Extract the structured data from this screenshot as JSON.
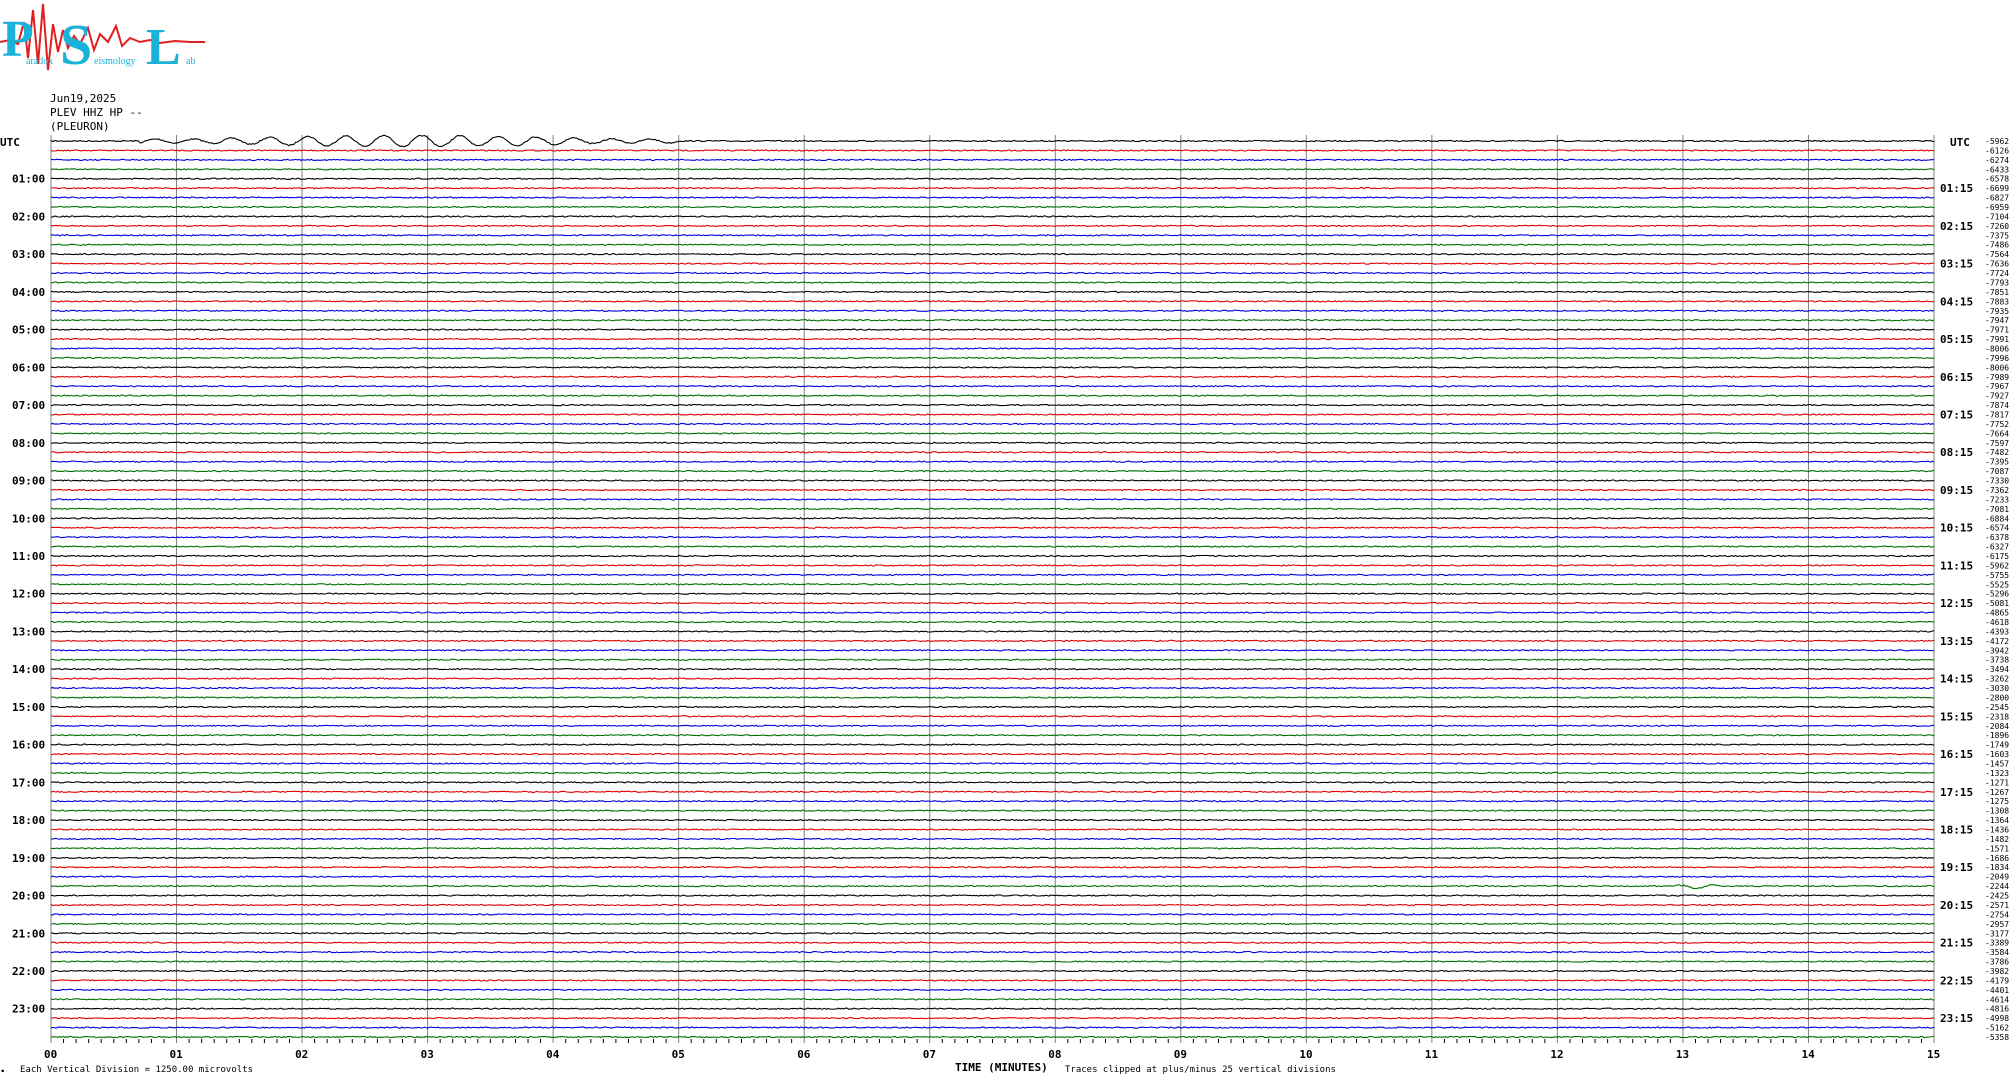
{
  "logo": {
    "p": "P",
    "s": "S",
    "l": "L",
    "tagline_a": "aradox",
    "tagline_b": "eismology",
    "tagline_c": "ab"
  },
  "header": {
    "date": "Jun19,2025",
    "station": "PLEV HHZ HP --",
    "location": "(PLEURON)"
  },
  "left_axis": {
    "title": "UTC",
    "hours": [
      "01:00",
      "02:00",
      "03:00",
      "04:00",
      "05:00",
      "06:00",
      "07:00",
      "08:00",
      "09:00",
      "10:00",
      "11:00",
      "12:00",
      "13:00",
      "14:00",
      "15:00",
      "16:00",
      "17:00",
      "18:00",
      "19:00",
      "20:00",
      "21:00",
      "22:00",
      "23:00"
    ]
  },
  "right_axis": {
    "title": "UTC",
    "hours": [
      "01:15",
      "02:15",
      "03:15",
      "04:15",
      "05:15",
      "06:15",
      "07:15",
      "08:15",
      "09:15",
      "10:15",
      "11:15",
      "12:15",
      "13:15",
      "14:15",
      "15:15",
      "16:15",
      "17:15",
      "18:15",
      "19:15",
      "20:15",
      "21:15",
      "22:15",
      "23:15"
    ]
  },
  "footer": {
    "xlabel": "TIME (MINUTES)",
    "vertical_division": "Each Vertical Division = 1250.00 microvolts",
    "clip_note": "Traces clipped at plus/minus 25 vertical divisions",
    "corner_mark": "∙"
  },
  "colors": {
    "trace_cycle": [
      "#000000",
      "#e00000",
      "#0000e0",
      "#007000"
    ],
    "grid": "#808080",
    "logo_cyan": "#1ab2d8",
    "logo_red": "#e02020"
  },
  "chart_data": {
    "type": "line",
    "title": "",
    "xlabel": "TIME (MINUTES)",
    "ylabel": "UTC",
    "x_ticks": [
      "00",
      "01",
      "02",
      "03",
      "04",
      "05",
      "06",
      "07",
      "08",
      "09",
      "10",
      "11",
      "12",
      "13",
      "14",
      "15"
    ],
    "xlim": [
      0,
      15
    ],
    "trace_count": 96,
    "trace_interval_minutes": 15,
    "grid": true,
    "offsets": [
      "-5962",
      "-6126",
      "-6274",
      "-6433",
      "-6578",
      "-6699",
      "-6827",
      "-6959",
      "-7104",
      "-7260",
      "-7375",
      "-7486",
      "-7564",
      "-7636",
      "-7724",
      "-7793",
      "-7851",
      "-7883",
      "-7935",
      "-7947",
      "-7971",
      "-7991",
      "-8006",
      "-7996",
      "-8006",
      "-7989",
      "-7967",
      "-7927",
      "-7874",
      "-7817",
      "-7752",
      "-7664",
      "-7597",
      "-7482",
      "-7395",
      "-7087",
      "-7330",
      "-7362",
      "-7233",
      "-7081",
      "-6884",
      "-6574",
      "-6378",
      "-6327",
      "-6175",
      "-5962",
      "-5755",
      "-5525",
      "-5296",
      "-5081",
      "-4865",
      "-4618",
      "-4393",
      "-4172",
      "-3942",
      "-3738",
      "-3494",
      "-3262",
      "-3030",
      "-2800",
      "-2545",
      "-2318",
      "-2084",
      "-1896",
      "-1749",
      "-1603",
      "-1457",
      "-1323",
      "-1271",
      "-1267",
      "-1275",
      "-1308",
      "-1364",
      "-1436",
      "-1482",
      "-1571",
      "-1686",
      "-1834",
      "-2049",
      "-2244",
      "-2425",
      "-2571",
      "-2754",
      "-2957",
      "-3177",
      "-3389",
      "-3584",
      "-3786",
      "-3982",
      "-4179",
      "-4401",
      "-4614",
      "-4816",
      "-4998",
      "-5162",
      "-5358"
    ],
    "events": [
      {
        "trace": 0,
        "start_min": 0.7,
        "end_min": 5.0,
        "amplitude": "large"
      },
      {
        "trace": 79,
        "start_min": 12.95,
        "end_min": 13.3,
        "amplitude": "small"
      }
    ]
  }
}
